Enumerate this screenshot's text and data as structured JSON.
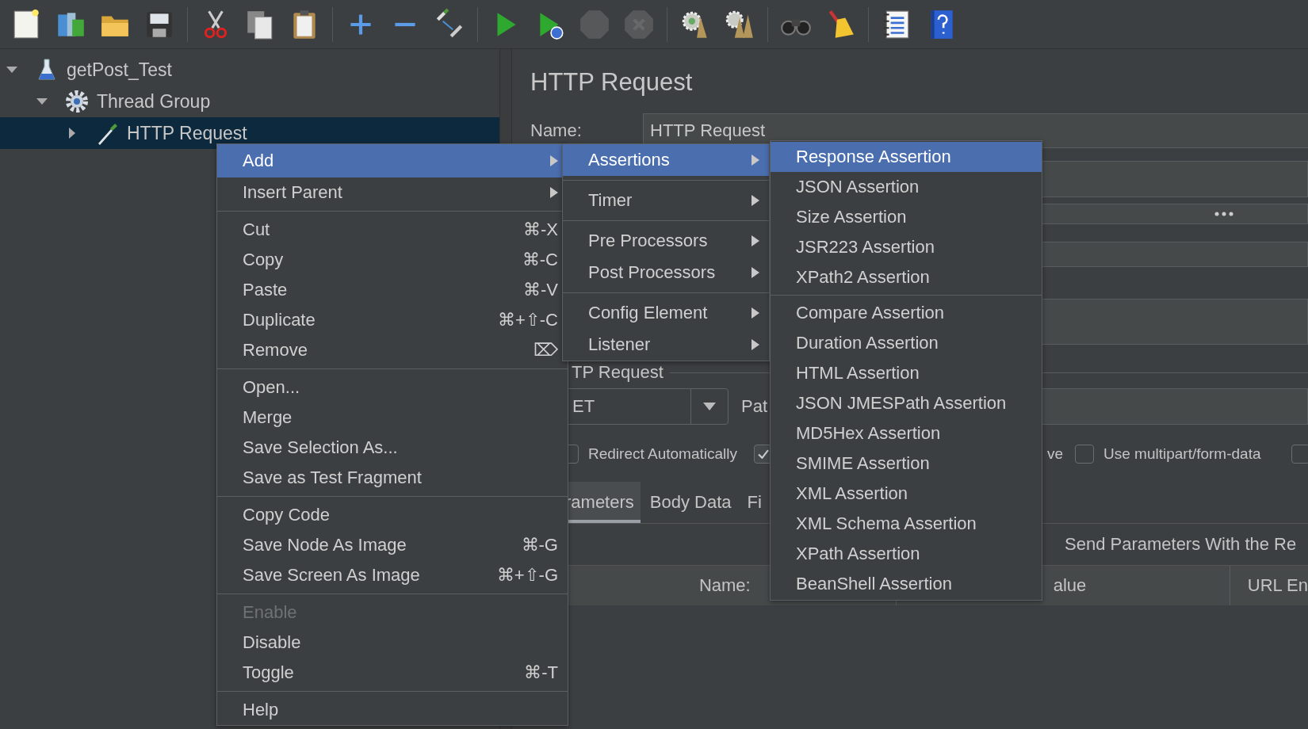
{
  "toolbar": [
    {
      "kind": "new",
      "disabled": false
    },
    {
      "kind": "templates",
      "disabled": false
    },
    {
      "kind": "open",
      "disabled": false
    },
    {
      "kind": "save",
      "disabled": false
    },
    {
      "kind": "separator"
    },
    {
      "kind": "cut",
      "disabled": false
    },
    {
      "kind": "copy",
      "disabled": false
    },
    {
      "kind": "paste",
      "disabled": false
    },
    {
      "kind": "separator"
    },
    {
      "kind": "expand",
      "disabled": false
    },
    {
      "kind": "collapse",
      "disabled": false
    },
    {
      "kind": "toggle",
      "disabled": false
    },
    {
      "kind": "separator"
    },
    {
      "kind": "start",
      "disabled": false
    },
    {
      "kind": "start_nopause",
      "disabled": false
    },
    {
      "kind": "stop",
      "disabled": true
    },
    {
      "kind": "shutdown",
      "disabled": true
    },
    {
      "kind": "separator"
    },
    {
      "kind": "clear",
      "disabled": false
    },
    {
      "kind": "clear_all",
      "disabled": false
    },
    {
      "kind": "separator"
    },
    {
      "kind": "search",
      "disabled": false
    },
    {
      "kind": "reset_search",
      "disabled": false
    },
    {
      "kind": "separator"
    },
    {
      "kind": "functions",
      "disabled": false
    },
    {
      "kind": "help",
      "disabled": false
    }
  ],
  "tree": [
    {
      "label": "getPost_Test",
      "kind": "plan",
      "expanded": true,
      "selected": false,
      "children": [
        {
          "label": "Thread Group",
          "kind": "group",
          "expanded": true,
          "selected": false,
          "children": [
            {
              "label": "HTTP Request",
              "kind": "sampler",
              "expanded": false,
              "selected": true
            }
          ]
        }
      ]
    }
  ],
  "panel": {
    "title": "HTTP Request",
    "name_label": "Name:",
    "name_value": "HTTP Request",
    "section_label": "TP Request",
    "method_value": "ET",
    "path_label": "Pat",
    "checkboxes": [
      {
        "label": "Redirect Automatically",
        "checked": false
      },
      {
        "checked": true
      },
      {
        "label": "ve"
      },
      {
        "label": "Use multipart/form-data",
        "checked": false
      },
      {
        "checked": false
      }
    ],
    "tabs": [
      {
        "label": "rameters",
        "selected": true
      },
      {
        "label": "Body Data",
        "selected": false
      },
      {
        "label": "Fi",
        "selected": false
      }
    ],
    "send_parameters_label": "Send Parameters With the Re",
    "table_columns": [
      "Name:",
      "alue",
      "URL En"
    ]
  },
  "context_menu": [
    {
      "kind": "item",
      "label": "Add",
      "submenu": true,
      "selected": true,
      "disabled": false
    },
    {
      "kind": "item",
      "label": "Insert Parent",
      "submenu": true,
      "selected": false,
      "disabled": false
    },
    {
      "kind": "separator"
    },
    {
      "kind": "item",
      "label": "Cut",
      "shortcut": "⌘-X",
      "selected": false,
      "disabled": false
    },
    {
      "kind": "item",
      "label": "Copy",
      "shortcut": "⌘-C",
      "selected": false,
      "disabled": false
    },
    {
      "kind": "item",
      "label": "Paste",
      "shortcut": "⌘-V",
      "selected": false,
      "disabled": false
    },
    {
      "kind": "item",
      "label": "Duplicate",
      "shortcut": "⌘+⇧-C",
      "selected": false,
      "disabled": false
    },
    {
      "kind": "item",
      "label": "Remove",
      "shortcut": "⌦",
      "selected": false,
      "disabled": false
    },
    {
      "kind": "separator"
    },
    {
      "kind": "item",
      "label": "Open...",
      "selected": false,
      "disabled": false
    },
    {
      "kind": "item",
      "label": "Merge",
      "selected": false,
      "disabled": false
    },
    {
      "kind": "item",
      "label": "Save Selection As...",
      "selected": false,
      "disabled": false
    },
    {
      "kind": "item",
      "label": "Save as Test Fragment",
      "selected": false,
      "disabled": false
    },
    {
      "kind": "separator"
    },
    {
      "kind": "item",
      "label": "Copy Code",
      "selected": false,
      "disabled": false
    },
    {
      "kind": "item",
      "label": "Save Node As Image",
      "shortcut": "⌘-G",
      "selected": false,
      "disabled": false
    },
    {
      "kind": "item",
      "label": "Save Screen As Image",
      "shortcut": "⌘+⇧-G",
      "selected": false,
      "disabled": false
    },
    {
      "kind": "separator"
    },
    {
      "kind": "item",
      "label": "Enable",
      "selected": false,
      "disabled": true
    },
    {
      "kind": "item",
      "label": "Disable",
      "selected": false,
      "disabled": false
    },
    {
      "kind": "item",
      "label": "Toggle",
      "shortcut": "⌘-T",
      "selected": false,
      "disabled": false
    },
    {
      "kind": "separator"
    },
    {
      "kind": "item",
      "label": "Help",
      "selected": false,
      "disabled": false
    }
  ],
  "add_submenu": [
    {
      "kind": "item",
      "label": "Assertions",
      "submenu": true,
      "selected": true
    },
    {
      "kind": "separator"
    },
    {
      "kind": "item",
      "label": "Timer",
      "submenu": true,
      "selected": false
    },
    {
      "kind": "separator"
    },
    {
      "kind": "item",
      "label": "Pre Processors",
      "submenu": true,
      "selected": false
    },
    {
      "kind": "item",
      "label": "Post Processors",
      "submenu": true,
      "selected": false
    },
    {
      "kind": "separator"
    },
    {
      "kind": "item",
      "label": "Config Element",
      "submenu": true,
      "selected": false
    },
    {
      "kind": "item",
      "label": "Listener",
      "submenu": true,
      "selected": false
    }
  ],
  "assertions_submenu": [
    {
      "kind": "item",
      "label": "Response Assertion",
      "selected": true
    },
    {
      "kind": "item",
      "label": "JSON Assertion",
      "selected": false
    },
    {
      "kind": "item",
      "label": "Size Assertion",
      "selected": false
    },
    {
      "kind": "item",
      "label": "JSR223 Assertion",
      "selected": false
    },
    {
      "kind": "item",
      "label": "XPath2 Assertion",
      "selected": false
    },
    {
      "kind": "separator"
    },
    {
      "kind": "item",
      "label": "Compare Assertion",
      "selected": false
    },
    {
      "kind": "item",
      "label": "Duration Assertion",
      "selected": false
    },
    {
      "kind": "item",
      "label": "HTML Assertion",
      "selected": false
    },
    {
      "kind": "item",
      "label": "JSON JMESPath Assertion",
      "selected": false
    },
    {
      "kind": "item",
      "label": "MD5Hex Assertion",
      "selected": false
    },
    {
      "kind": "item",
      "label": "SMIME Assertion",
      "selected": false
    },
    {
      "kind": "item",
      "label": "XML Assertion",
      "selected": false
    },
    {
      "kind": "item",
      "label": "XML Schema Assertion",
      "selected": false
    },
    {
      "kind": "item",
      "label": "XPath Assertion",
      "selected": false
    },
    {
      "kind": "item",
      "label": "BeanShell Assertion",
      "selected": false
    }
  ]
}
